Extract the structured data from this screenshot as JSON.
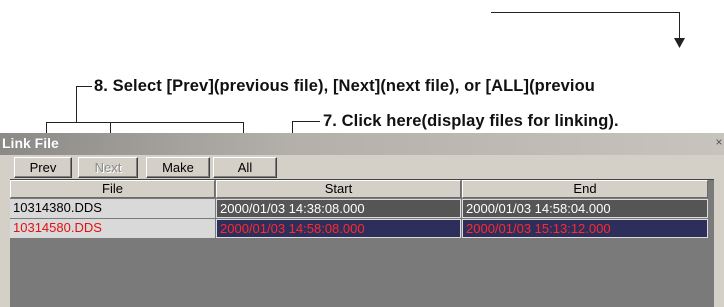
{
  "annotations": {
    "step8": "8. Select [Prev](previous file), [Next](next file), or [ALL](previou",
    "step7": "7. Click here(display files for linking)."
  },
  "window": {
    "title": "Link File",
    "close_glyph": "×"
  },
  "toolbar": {
    "prev_label": "Prev",
    "next_label": "Next",
    "make_label": "Make",
    "all_label": "All"
  },
  "table": {
    "columns": [
      "File",
      "Start",
      "End"
    ],
    "rows": [
      {
        "file": "10314380.DDS",
        "start": "2000/01/03 14:38:08.000",
        "end": "2000/01/03 14:58:04.000"
      },
      {
        "file": "10314580.DDS",
        "start": "2000/01/03 14:58:08.000",
        "end": "2000/01/03 15:13:12.000"
      }
    ]
  },
  "colors": {
    "window_bg": "#d4d0c8",
    "grid_bg": "#7a7a7a",
    "selected_row_text": "#e31010",
    "selected_row_bg": "#2e2e5c"
  },
  "icons": [
    "close-icon",
    "down-arrow-icon"
  ]
}
